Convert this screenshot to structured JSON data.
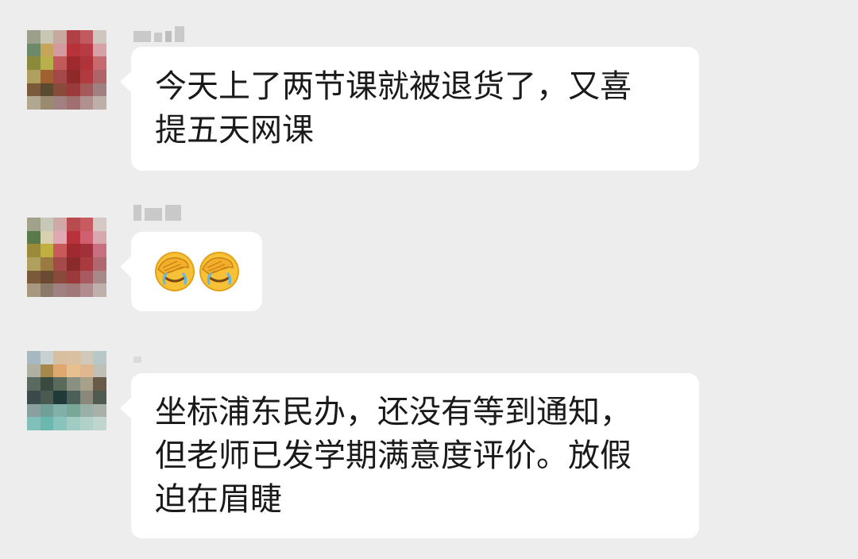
{
  "messages": [
    {
      "lines": [
        "今天上了两节课就被退货了，又喜",
        "提五天网课"
      ]
    },
    {
      "emoji": [
        "face-palm-emoji",
        "face-palm-emoji"
      ]
    },
    {
      "lines": [
        "坐标浦东民办，还没有等到通知，",
        "但老师已发学期满意度评价。放假",
        "迫在眉睫"
      ]
    }
  ],
  "colors": {
    "background": "#ededed",
    "bubble": "#ffffff",
    "text": "#1a1a1a",
    "sender_placeholder": "#c9c9c9"
  }
}
